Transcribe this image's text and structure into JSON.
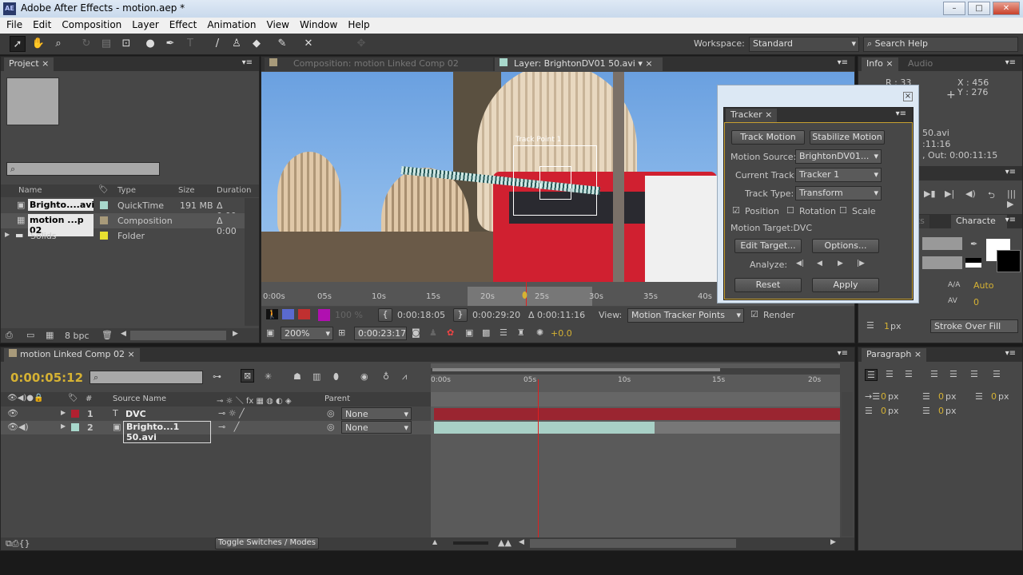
{
  "window": {
    "title": "Adobe After Effects - motion.aep *",
    "app_icon": "AE",
    "minimize": "–",
    "maximize": "□",
    "close": "✕"
  },
  "menu": [
    "File",
    "Edit",
    "Composition",
    "Layer",
    "Effect",
    "Animation",
    "View",
    "Window",
    "Help"
  ],
  "toolbar": {
    "workspace_label": "Workspace:",
    "workspace_value": "Standard",
    "search_placeholder": "Search Help"
  },
  "project": {
    "tab": "Project",
    "columns": [
      "Name",
      "Type",
      "Size",
      "Duration"
    ],
    "items": [
      {
        "name": "Brighto....avi",
        "type": "QuickTime",
        "size": "191 MB",
        "duration": "Δ 0:00",
        "color": "#a8d8cc"
      },
      {
        "name": "motion ...p 02",
        "type": "Composition",
        "size": "",
        "duration": "Δ 0:00",
        "color": "#a89a7a"
      },
      {
        "name": "Solids",
        "type": "Folder",
        "size": "",
        "duration": "",
        "color": "#e8e030"
      }
    ],
    "bpc": "8 bpc"
  },
  "viewer": {
    "comp_tab": "Composition: motion Linked Comp 02",
    "layer_tab": "Layer: BrightonDV01 50.avi",
    "track_point_label": "Track Point 1",
    "ruler": [
      "0:00s",
      "05s",
      "10s",
      "15s",
      "20s",
      "25s",
      "30s",
      "35s",
      "40s"
    ],
    "opacity": "100 %",
    "in_time": "0:00:18:05",
    "out_time": "0:00:29:20",
    "duration": "Δ 0:00:11:16",
    "view_label": "View:",
    "view_value": "Motion Tracker Points",
    "render_label": "Render",
    "render_checked": true,
    "zoom": "200%",
    "current_time": "0:00:23:17",
    "exposure": "+0.0"
  },
  "tracker": {
    "tab": "Tracker",
    "track_motion": "Track Motion",
    "stabilize_motion": "Stabilize Motion",
    "motion_source_label": "Motion Source:",
    "motion_source": "BrightonDV01...",
    "current_track_label": "Current Track:",
    "current_track": "Tracker 1",
    "track_type_label": "Track Type:",
    "track_type": "Transform",
    "position": "Position",
    "position_checked": true,
    "rotation": "Rotation",
    "rotation_checked": false,
    "scale": "Scale",
    "scale_checked": false,
    "motion_target": "Motion Target:DVC",
    "edit_target": "Edit Target...",
    "options": "Options...",
    "analyze_label": "Analyze:",
    "reset": "Reset",
    "apply": "Apply"
  },
  "info": {
    "tab": "Info",
    "audio_tab": "Audio",
    "r": "R : 33",
    "x": "X : 456",
    "y": "Y : 276",
    "line1": "50.avi",
    "line2": ":11:16",
    "line3": ", Out: 0:00:11:15"
  },
  "character": {
    "tab_prev": "ets",
    "tab": "Characte",
    "leading": "Auto",
    "tracking": "0",
    "stroke_width": "1",
    "stroke_unit": "px",
    "stroke_mode": "Stroke Over Fill"
  },
  "paragraph": {
    "tab": "Paragraph",
    "indent_values": [
      "0",
      "0",
      "0",
      "0",
      "0"
    ],
    "unit": "px"
  },
  "timeline": {
    "tab": "motion Linked Comp 02",
    "current_time": "0:00:05:12",
    "col_source": "Source Name",
    "col_parent": "Parent",
    "col_num": "#",
    "ruler": [
      "0:00s",
      "05s",
      "10s",
      "15s",
      "20s"
    ],
    "layers": [
      {
        "num": "1",
        "name": "DVC",
        "type_icon": "T",
        "color": "#b02030",
        "parent": "None"
      },
      {
        "num": "2",
        "name": "Brighto...1 50.avi",
        "type_icon": "▣",
        "color": "#a8d8cc",
        "parent": "None"
      }
    ],
    "toggle": "Toggle Switches / Modes"
  }
}
